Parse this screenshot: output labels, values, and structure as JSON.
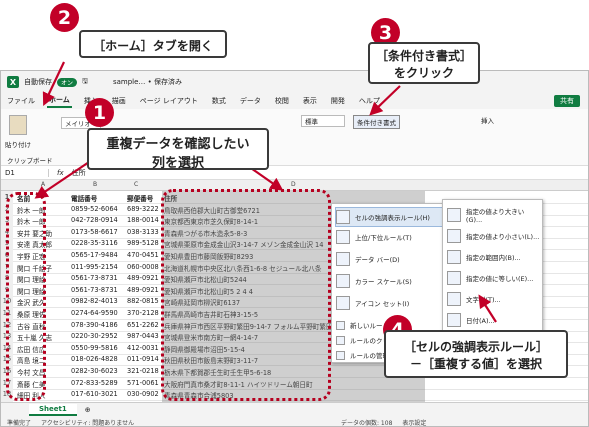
{
  "window": {
    "autosave": "自動保存",
    "toggle": "オン",
    "filename": "sample… • 保存済み"
  },
  "menu": [
    "ファイル",
    "ホーム",
    "挿入",
    "描画",
    "ページ レイアウト",
    "数式",
    "データ",
    "校閲",
    "表示",
    "開発",
    "ヘルプ"
  ],
  "share": "共有",
  "ribbon": {
    "paste": "貼り付け",
    "clipboard": "クリップボード",
    "font": "メイリオ",
    "number_format": "標準",
    "cond_format": "条件付き書式",
    "insert": "挿入"
  },
  "namebox": "D1",
  "formula": "住所",
  "columns": [
    "A",
    "B",
    "C",
    "D"
  ],
  "headers": [
    "名前",
    "電話番号",
    "郵便番号",
    "住所"
  ],
  "rows": [
    {
      "n": "2",
      "name": "鈴木 一郎",
      "tel": "0859-52-6064",
      "zip": "689-3222",
      "addr": "鳥取県西伯郡大山町古御堂6721"
    },
    {
      "n": "3",
      "name": "鈴木 一郎",
      "tel": "042-728-0914",
      "zip": "188-0014",
      "addr": "東京都西東京市芝久保町8-14-1"
    },
    {
      "n": "4",
      "name": "安井 要之助",
      "tel": "0173-58-6617",
      "zip": "038-3133",
      "addr": "青森県つがる市木造永5-8-3"
    },
    {
      "n": "5",
      "name": "安達 真太郎",
      "tel": "0228-35-3116",
      "zip": "989-5128",
      "addr": "宮城県栗原市金成金山沢3-14-7 メゾン金成金山沢 14"
    },
    {
      "n": "6",
      "name": "宇野 正宏",
      "tel": "0565-17-9484",
      "zip": "470-0451",
      "addr": "愛知県豊田市藤岡飯野町8293"
    },
    {
      "n": "7",
      "name": "関口 千絵子",
      "tel": "011-995-2154",
      "zip": "060-0008",
      "addr": "北海道札幌市中央区北八条西1-6-8 セジュール北八条"
    },
    {
      "n": "8",
      "name": "関口 理絵",
      "tel": "0561-73-8731",
      "zip": "489-0921",
      "addr": "愛知県瀬戸市北松山町5244"
    },
    {
      "n": "9",
      "name": "関口 理絵",
      "tel": "0561-73-8731",
      "zip": "489-0921",
      "addr": "愛知県瀬戸市北松山町5 2 4 4"
    },
    {
      "n": "10",
      "name": "金沢 武久",
      "tel": "0982-82-4013",
      "zip": "882-0815",
      "addr": "宮崎県延岡市柳沢町6137"
    },
    {
      "n": "11",
      "name": "桑原 理佐",
      "tel": "0274-64-9590",
      "zip": "370-2128",
      "addr": "群馬県高崎市吉井町石神3-15-5"
    },
    {
      "n": "12",
      "name": "古谷 直秋",
      "tel": "078-390-4186",
      "zip": "651-2262",
      "addr": "兵庫県神戸市西区平野町繁田9-14-7 フォルム平野町繁田 513号室"
    },
    {
      "n": "13",
      "name": "五十嵐 久志",
      "tel": "0220-30-2952",
      "zip": "987-0443",
      "addr": "宮城県登米市南方町一網4-14-7"
    },
    {
      "n": "14",
      "name": "広田 信広",
      "tel": "0550-99-5816",
      "zip": "412-0031",
      "addr": "静岡県御殿場市沼田5-15-4"
    },
    {
      "n": "15",
      "name": "高島 境二",
      "tel": "018-026-4828",
      "zip": "011-0914",
      "addr": "秋田県秋田市飯島末野町3-11-7"
    },
    {
      "n": "16",
      "name": "今村 文昌",
      "tel": "0282-30-6023",
      "zip": "321-0218",
      "addr": "栃木県下都賀郡壬生町壬生甲5-6-18"
    },
    {
      "n": "17",
      "name": "斎藤 仁美",
      "tel": "072-833-5289",
      "zip": "571-0061",
      "addr": "大阪府門真市桑才町8-11-1 ハイツドリーム朝日町"
    },
    {
      "n": "18",
      "name": "細田 利人",
      "tel": "017-610-3021",
      "zip": "030-0902",
      "addr": "青森県青森市合浦5803"
    },
    {
      "n": "19",
      "name": "山崎 佐之",
      "tel": "0254-44-8036",
      "zip": "957-0123",
      "addr": "新潟県北蒲原郡聖籠町東港3-9-1"
    }
  ],
  "menu1": [
    "セルの強調表示ルール(H)",
    "上位/下位ルール(T)",
    "データ バー(D)",
    "カラー スケール(S)",
    "アイコン セット(I)",
    "新しいルール(N)...",
    "ルールのクリア(C)",
    "ルールの管理(R)..."
  ],
  "menu2": [
    "指定の値より大きい(G)...",
    "指定の値より小さい(L)...",
    "指定の範囲内(B)...",
    "指定の値に等しい(E)...",
    "文字列(T)...",
    "日付(A)...",
    "重複する値(D)...",
    "その他のルール(M)..."
  ],
  "sheet": "Sheet1",
  "status": {
    "ready": "準備完了",
    "accessibility": "アクセシビリティ: 問題ありません",
    "count": "データの個数: 108",
    "display": "表示設定"
  },
  "callouts": {
    "n1": "1",
    "n2": "2",
    "n3": "3",
    "n4": "4",
    "c1_line1": "重複データを確認したい",
    "c1_line2": "列を選択",
    "c2": "［ホーム］タブを開く",
    "c3_line1": "［条件付き書式］",
    "c3_line2": "をクリック",
    "c4_line1": "［セルの強調表示ルール］",
    "c4_line2": "－［重複する値］を選択"
  },
  "colors": {
    "accent": "#c20028",
    "excel": "#107c41"
  }
}
